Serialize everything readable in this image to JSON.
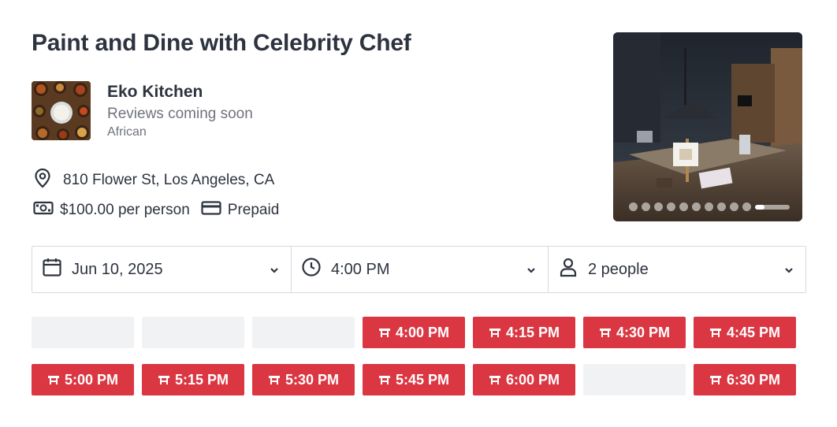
{
  "experience": {
    "title": "Paint and Dine with Celebrity Chef"
  },
  "restaurant": {
    "name": "Eko Kitchen",
    "reviews": "Reviews coming soon",
    "cuisine": "African"
  },
  "details": {
    "address": "810 Flower St, Los Angeles, CA",
    "price": "$100.00 per person",
    "payment": "Prepaid"
  },
  "gallery": {
    "total_images": 11,
    "active_index": 10
  },
  "selectors": {
    "date": "Jun 10, 2025",
    "time": "4:00 PM",
    "party": "2 people"
  },
  "slots": [
    {
      "time": "",
      "available": false
    },
    {
      "time": "",
      "available": false
    },
    {
      "time": "",
      "available": false
    },
    {
      "time": "4:00 PM",
      "available": true
    },
    {
      "time": "4:15 PM",
      "available": true
    },
    {
      "time": "4:30 PM",
      "available": true
    },
    {
      "time": "4:45 PM",
      "available": true
    },
    {
      "time": "5:00 PM",
      "available": true
    },
    {
      "time": "5:15 PM",
      "available": true
    },
    {
      "time": "5:30 PM",
      "available": true
    },
    {
      "time": "5:45 PM",
      "available": true
    },
    {
      "time": "6:00 PM",
      "available": true
    },
    {
      "time": "",
      "available": false
    },
    {
      "time": "6:30 PM",
      "available": true
    }
  ],
  "colors": {
    "accent": "#da3743",
    "text": "#2d333f",
    "muted": "#6f737b",
    "border": "#d8d9db",
    "placeholder": "#f1f2f4"
  },
  "icons": {
    "address": "map-pin-icon",
    "price": "cash-icon",
    "payment": "credit-card-icon",
    "date": "calendar-icon",
    "time": "clock-icon",
    "party": "person-icon",
    "dropdown": "chevron-down-icon",
    "slot": "table-icon"
  }
}
